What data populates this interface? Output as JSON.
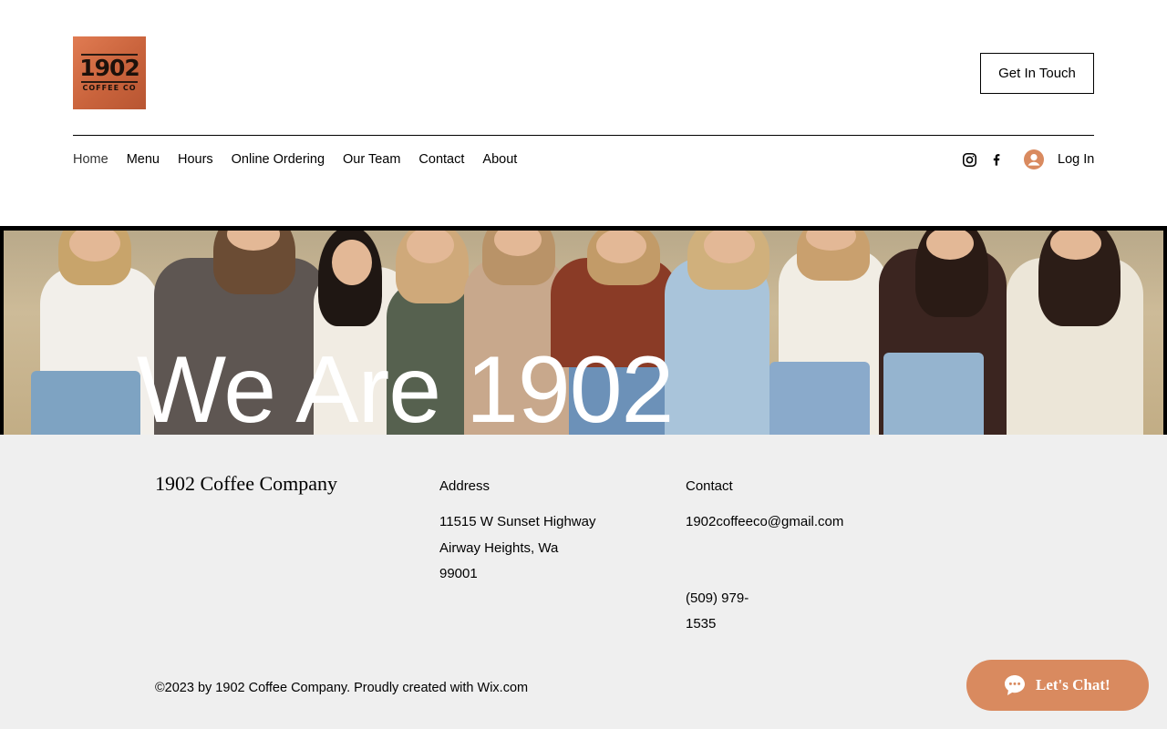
{
  "header": {
    "logo": {
      "main": "1902",
      "sub": "COFFEE CO"
    },
    "cta_label": "Get In Touch",
    "nav": [
      "Home",
      "Menu",
      "Hours",
      "Online Ordering",
      "Our Team",
      "Contact",
      "About"
    ],
    "social": [
      {
        "name": "instagram-icon"
      },
      {
        "name": "facebook-icon"
      }
    ],
    "login_label": "Log In"
  },
  "hero": {
    "title": "We Are 1902"
  },
  "footer": {
    "company": "1902 Coffee Company",
    "address": {
      "heading": "Address",
      "line1": "11515 W Sunset Highway",
      "line2": "Airway Heights, Wa",
      "line3": "99001"
    },
    "contact": {
      "heading": "Contact",
      "email": "1902coffeeco@gmail.com",
      "phone_line1": "(509) 979-",
      "phone_line2": "1535"
    },
    "copyright": "©2023 by 1902 Coffee Company. Proudly created with Wix.com"
  },
  "chat": {
    "label": "Let's Chat!"
  },
  "colors": {
    "accent": "#d98a5f",
    "footer_bg": "#efefef",
    "logo_bg": "#c9633c"
  }
}
